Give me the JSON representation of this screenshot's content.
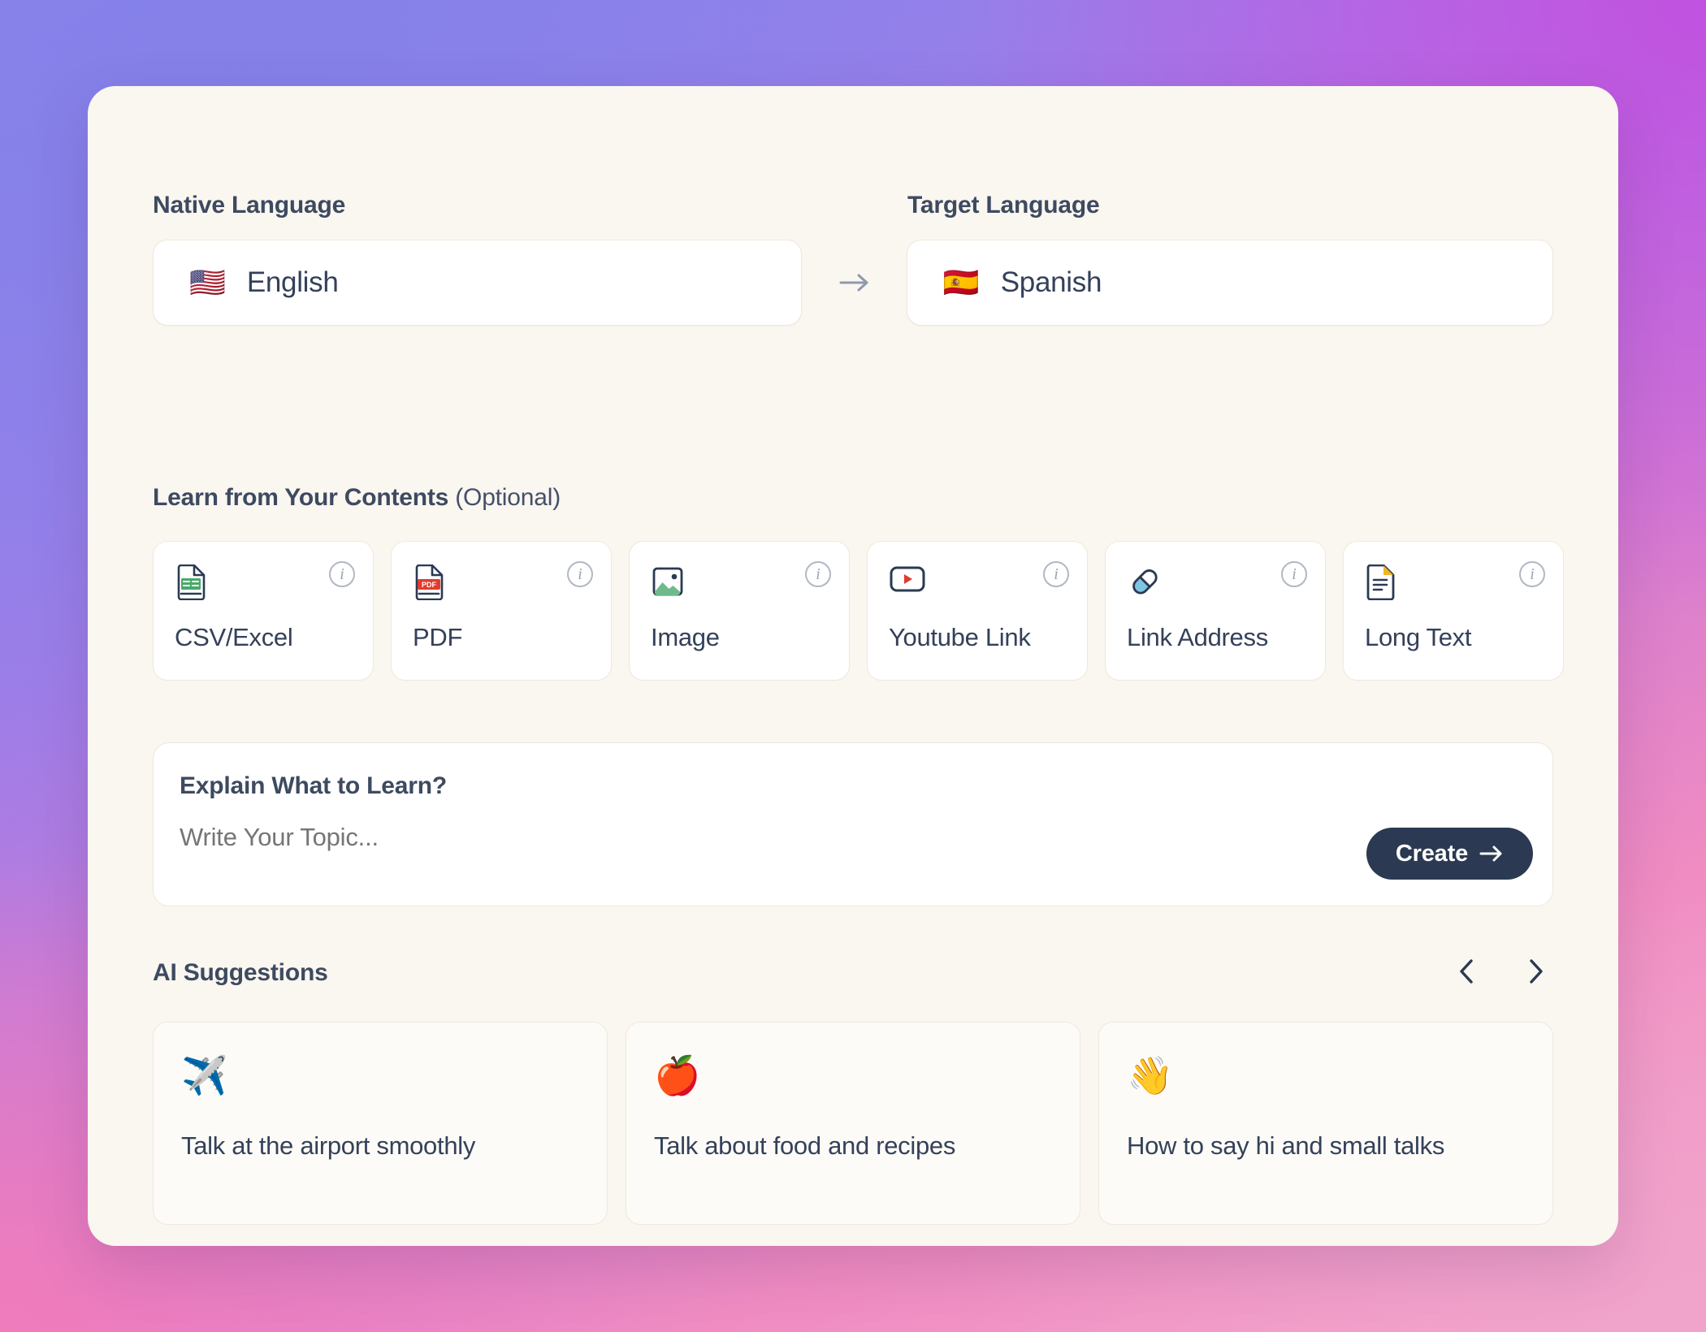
{
  "languages": {
    "native_label": "Native Language",
    "target_label": "Target Language",
    "native_flag": "🇺🇸",
    "native_value": "English",
    "target_flag": "🇪🇸",
    "target_value": "Spanish",
    "arrow_icon": "arrow-right-icon"
  },
  "contents": {
    "heading_bold": "Learn from Your Contents",
    "heading_optional": "(Optional)",
    "info_char": "i",
    "items": [
      {
        "label": "CSV/Excel",
        "emoji": "🗒️",
        "icon_name": "csv-excel-file-icon"
      },
      {
        "label": "PDF",
        "emoji": "📕",
        "icon_name": "pdf-file-icon"
      },
      {
        "label": "Image",
        "emoji": "🖼️",
        "icon_name": "image-icon"
      },
      {
        "label": "Youtube Link",
        "emoji": "📺",
        "icon_name": "youtube-play-icon"
      },
      {
        "label": "Link Address",
        "emoji": "💊",
        "icon_name": "link-pill-icon"
      },
      {
        "label": "Long Text",
        "emoji": "📄",
        "icon_name": "long-text-document-icon"
      }
    ]
  },
  "explain": {
    "title": "Explain What to Learn?",
    "placeholder": "Write Your Topic...",
    "value": "",
    "create_label": "Create",
    "create_arrow": "→"
  },
  "suggestions": {
    "title": "AI Suggestions",
    "prev_icon": "chevron-left-icon",
    "next_icon": "chevron-right-icon",
    "cards": [
      {
        "emoji": "✈️",
        "text": "Talk at the airport smoothly"
      },
      {
        "emoji": "🍎",
        "text": "Talk about food and recipes"
      },
      {
        "emoji": "👋",
        "text": "How to say hi and small talks"
      }
    ]
  },
  "theme": {
    "card_bg": "#faf6f0",
    "accent_dark": "#2b3a52",
    "text": "#34415a",
    "border": "#f0e8dc"
  }
}
